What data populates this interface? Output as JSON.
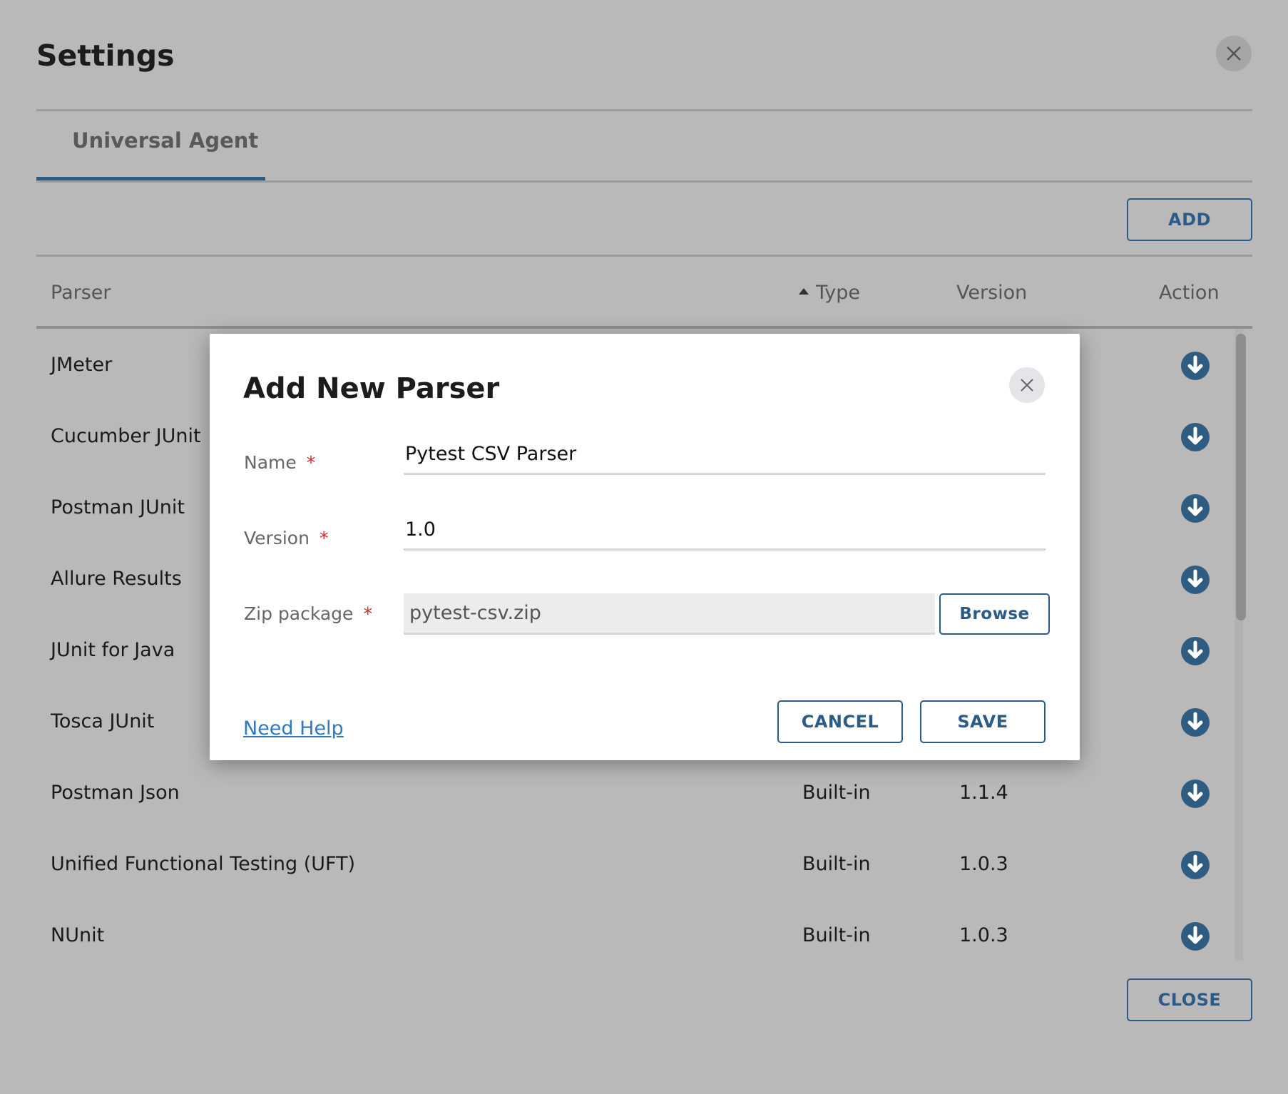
{
  "settings": {
    "title": "Settings",
    "tab_label": "Universal Agent",
    "add_label": "ADD",
    "close_label": "CLOSE",
    "columns": {
      "parser": "Parser",
      "type": "Type",
      "version": "Version",
      "action": "Action"
    },
    "rows": [
      {
        "name": "JMeter",
        "type": "",
        "version": ""
      },
      {
        "name": "Cucumber JUnit",
        "type": "",
        "version": ""
      },
      {
        "name": "Postman JUnit",
        "type": "",
        "version": ""
      },
      {
        "name": "Allure Results",
        "type": "",
        "version": ""
      },
      {
        "name": "JUnit for Java",
        "type": "",
        "version": ""
      },
      {
        "name": "Tosca JUnit",
        "type": "",
        "version": ""
      },
      {
        "name": "Postman Json",
        "type": "Built-in",
        "version": "1.1.4"
      },
      {
        "name": "Unified Functional Testing (UFT)",
        "type": "Built-in",
        "version": "1.0.3"
      },
      {
        "name": "NUnit",
        "type": "Built-in",
        "version": "1.0.3"
      }
    ]
  },
  "modal": {
    "title": "Add New Parser",
    "name_label": "Name",
    "name_value": "Pytest CSV Parser",
    "version_label": "Version",
    "version_value": "1.0",
    "zip_label": "Zip package",
    "zip_value": "pytest-csv.zip",
    "required_mark": "*",
    "browse_label": "Browse",
    "help_label": "Need Help",
    "cancel_label": "CANCEL",
    "save_label": "SAVE"
  },
  "colors": {
    "accent": "#2b5b86",
    "required": "#d42a2a",
    "link": "#2f78c2",
    "icon": "#2f5d82"
  },
  "icons": {
    "close": "close-icon",
    "download": "download-circle-icon",
    "sort": "sort-ascending-icon"
  }
}
